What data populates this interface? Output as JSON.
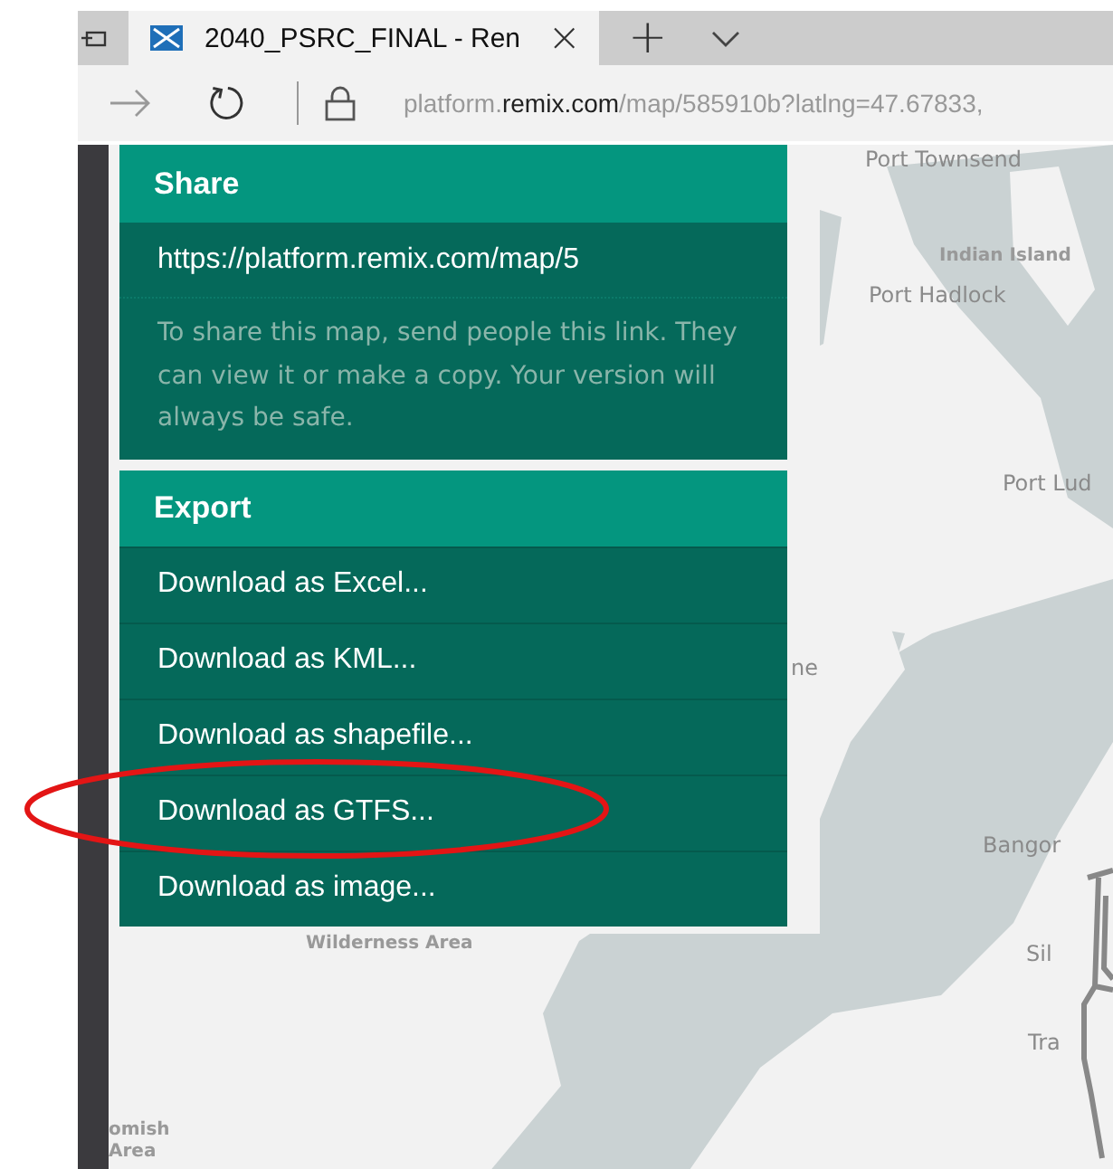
{
  "browser": {
    "tab": {
      "title": "2040_PSRC_FINAL - Ren",
      "close": "×",
      "selected": true
    },
    "new_tab": "+",
    "address": "platform.**remix.com**/map/585910b?latlng=47.67833,"
  },
  "share": {
    "title": "Share",
    "link": "https://platform.remix.com/map/5",
    "description": "To share this map, send people this link. They can view it or make a copy. Your version will always be safe."
  },
  "export": {
    "title": "Export",
    "items": [
      {
        "label": "Download as Excel...",
        "circled": false
      },
      {
        "label": "Download as KML...",
        "circled": false
      },
      {
        "label": "Download as shapefile...",
        "circled": false
      },
      {
        "label": "Download as GTFS...",
        "circled": true
      },
      {
        "label": "Download as image...",
        "circled": false
      }
    ]
  },
  "map": {
    "labels": [
      {
        "text": "Port Townsend",
        "kind": "town"
      },
      {
        "text": "Indian Island",
        "kind": "area"
      },
      {
        "text": "Port Hadlock",
        "kind": "town"
      },
      {
        "text": "Port Lud",
        "kind": "town"
      },
      {
        "text": "ne",
        "kind": "town"
      },
      {
        "text": "Bangor",
        "kind": "town"
      },
      {
        "text": "Sil",
        "kind": "town"
      },
      {
        "text": "Tra",
        "kind": "town"
      },
      {
        "text": "Wilderness Area",
        "kind": "area"
      },
      {
        "text": "omish",
        "kind": "area"
      },
      {
        "text": "Area",
        "kind": "area"
      }
    ]
  }
}
